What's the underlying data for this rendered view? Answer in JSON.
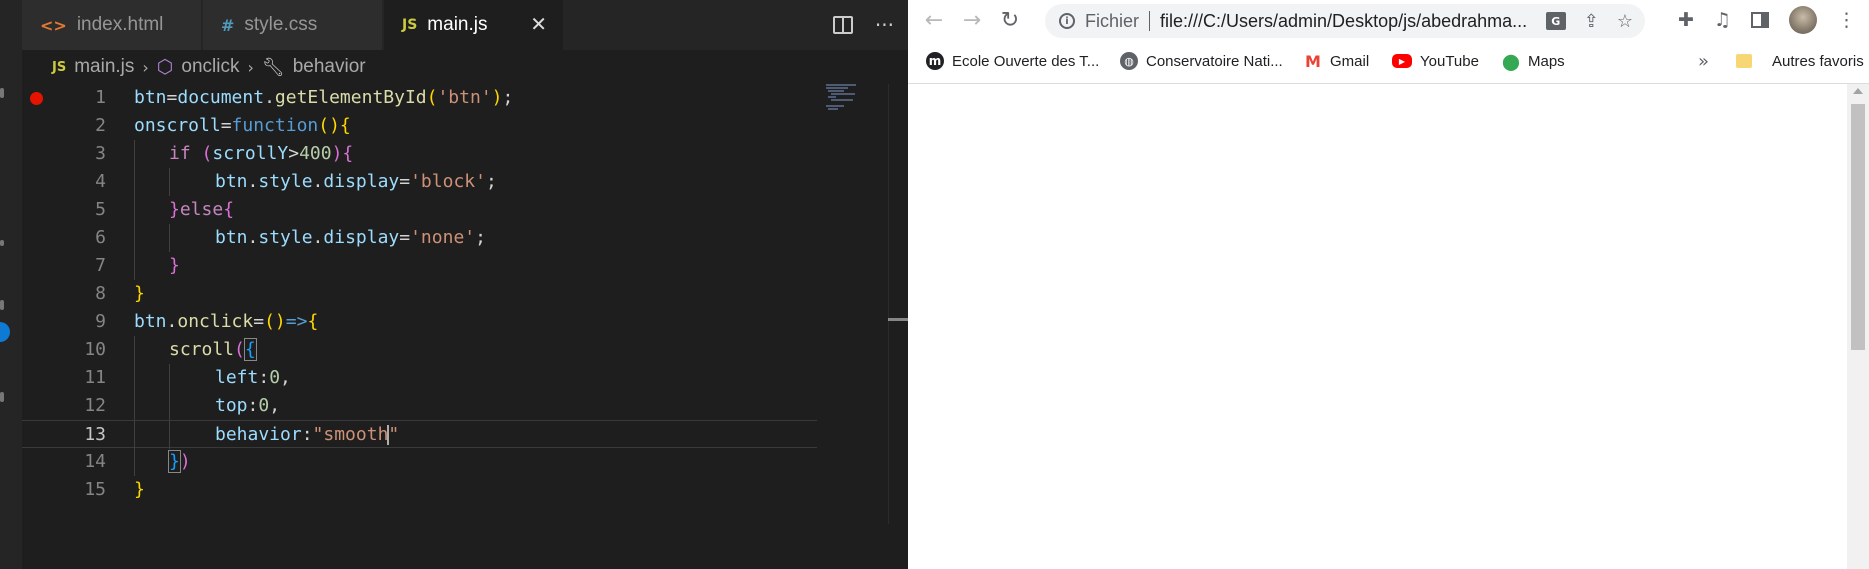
{
  "editor": {
    "tabs": [
      {
        "icon": "<>",
        "label": "index.html"
      },
      {
        "icon": "#",
        "label": "style.css"
      },
      {
        "icon": "JS",
        "label": "main.js"
      }
    ],
    "close_glyph": "✕",
    "more_glyph": "···",
    "breadcrumb": {
      "file_icon": "JS",
      "file": "main.js",
      "symbol1": "onclick",
      "symbol2": "behavior"
    },
    "line_numbers": [
      "1",
      "2",
      "3",
      "4",
      "5",
      "6",
      "7",
      "8",
      "9",
      "10",
      "11",
      "12",
      "13",
      "14",
      "15"
    ],
    "code": {
      "l1": [
        "btn",
        "=",
        "document",
        ".",
        "getElementById",
        "(",
        "'btn'",
        ")",
        ";"
      ],
      "l2": [
        "onscroll",
        "=",
        "function",
        "(){"
      ],
      "l3": [
        "if",
        " (",
        "scrollY",
        ">",
        "400",
        "){"
      ],
      "l4": [
        "btn",
        ".",
        "style",
        ".",
        "display",
        "=",
        "'block'",
        ";"
      ],
      "l5": [
        "}",
        "else",
        "{"
      ],
      "l6": [
        "btn",
        ".",
        "style",
        ".",
        "display",
        "=",
        "'none'",
        ";"
      ],
      "l7": [
        "}"
      ],
      "l8": [
        "}"
      ],
      "l9": [
        "btn",
        ".",
        "onclick",
        "=",
        "()",
        "=>",
        "{"
      ],
      "l10": [
        "scroll",
        "(",
        "{"
      ],
      "l11": [
        "left",
        ":",
        "0",
        ","
      ],
      "l12": [
        "top",
        ":",
        "0",
        ","
      ],
      "l13": [
        "behavior",
        ":",
        "\"smooth",
        "\""
      ],
      "l14": [
        "}",
        ")"
      ],
      "l15": [
        "}"
      ]
    }
  },
  "browser": {
    "back_glyph": "←",
    "forward_glyph": "→",
    "reload_glyph": "↻",
    "scheme_label": "Fichier",
    "url": "file:///C:/Users/admin/Desktop/js/abedrahma...",
    "bookmarks": [
      {
        "label": "Ecole Ouverte des T..."
      },
      {
        "label": "Conservatoire Nati..."
      },
      {
        "label": "Gmail"
      },
      {
        "label": "YouTube"
      },
      {
        "label": "Maps"
      }
    ],
    "overflow_glyph": "»",
    "other_bookmarks": "Autres favoris"
  }
}
